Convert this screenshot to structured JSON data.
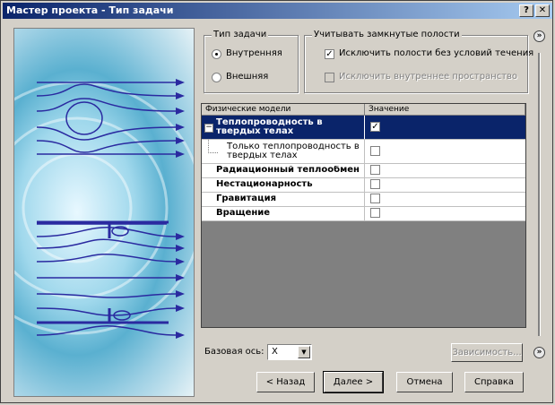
{
  "window": {
    "title": "Мастер проекта - Тип задачи",
    "help_glyph": "?",
    "close_glyph": "✕"
  },
  "task_type": {
    "legend": "Тип задачи",
    "options": [
      {
        "label": "Внутренняя",
        "selected": true
      },
      {
        "label": "Внешняя",
        "selected": false
      }
    ]
  },
  "closed_cavities": {
    "legend": "Учитывать замкнутые полости",
    "options": [
      {
        "label": "Исключить полости без условий течения",
        "checked": true,
        "enabled": true
      },
      {
        "label": "Исключить внутреннее пространство",
        "checked": false,
        "enabled": false
      }
    ]
  },
  "grid": {
    "columns": [
      "Физические модели",
      "Значение"
    ],
    "rows": [
      {
        "label": "Теплопроводность в твердых телах",
        "checked": true,
        "selected": true,
        "expander": "−"
      },
      {
        "label": "Только теплопроводность в твердых телах",
        "checked": false,
        "indent": true
      },
      {
        "label": "Радиационный теплообмен",
        "checked": false
      },
      {
        "label": "Нестационарность",
        "checked": false
      },
      {
        "label": "Гравитация",
        "checked": false
      },
      {
        "label": "Вращение",
        "checked": false
      }
    ]
  },
  "base_axis": {
    "label": "Базовая ось:",
    "value": "X",
    "arrow": "▼"
  },
  "buttons": {
    "dependency": "Зависимость...",
    "back": "< Назад",
    "next": "Далее >",
    "cancel": "Отмена",
    "help": "Справка"
  },
  "side_glyph": "»",
  "checkmark": "✓",
  "colors": {
    "title_start": "#0a246a",
    "title_end": "#a6caf0",
    "selection": "#0a246a",
    "arrows": "#2a2aa0"
  }
}
